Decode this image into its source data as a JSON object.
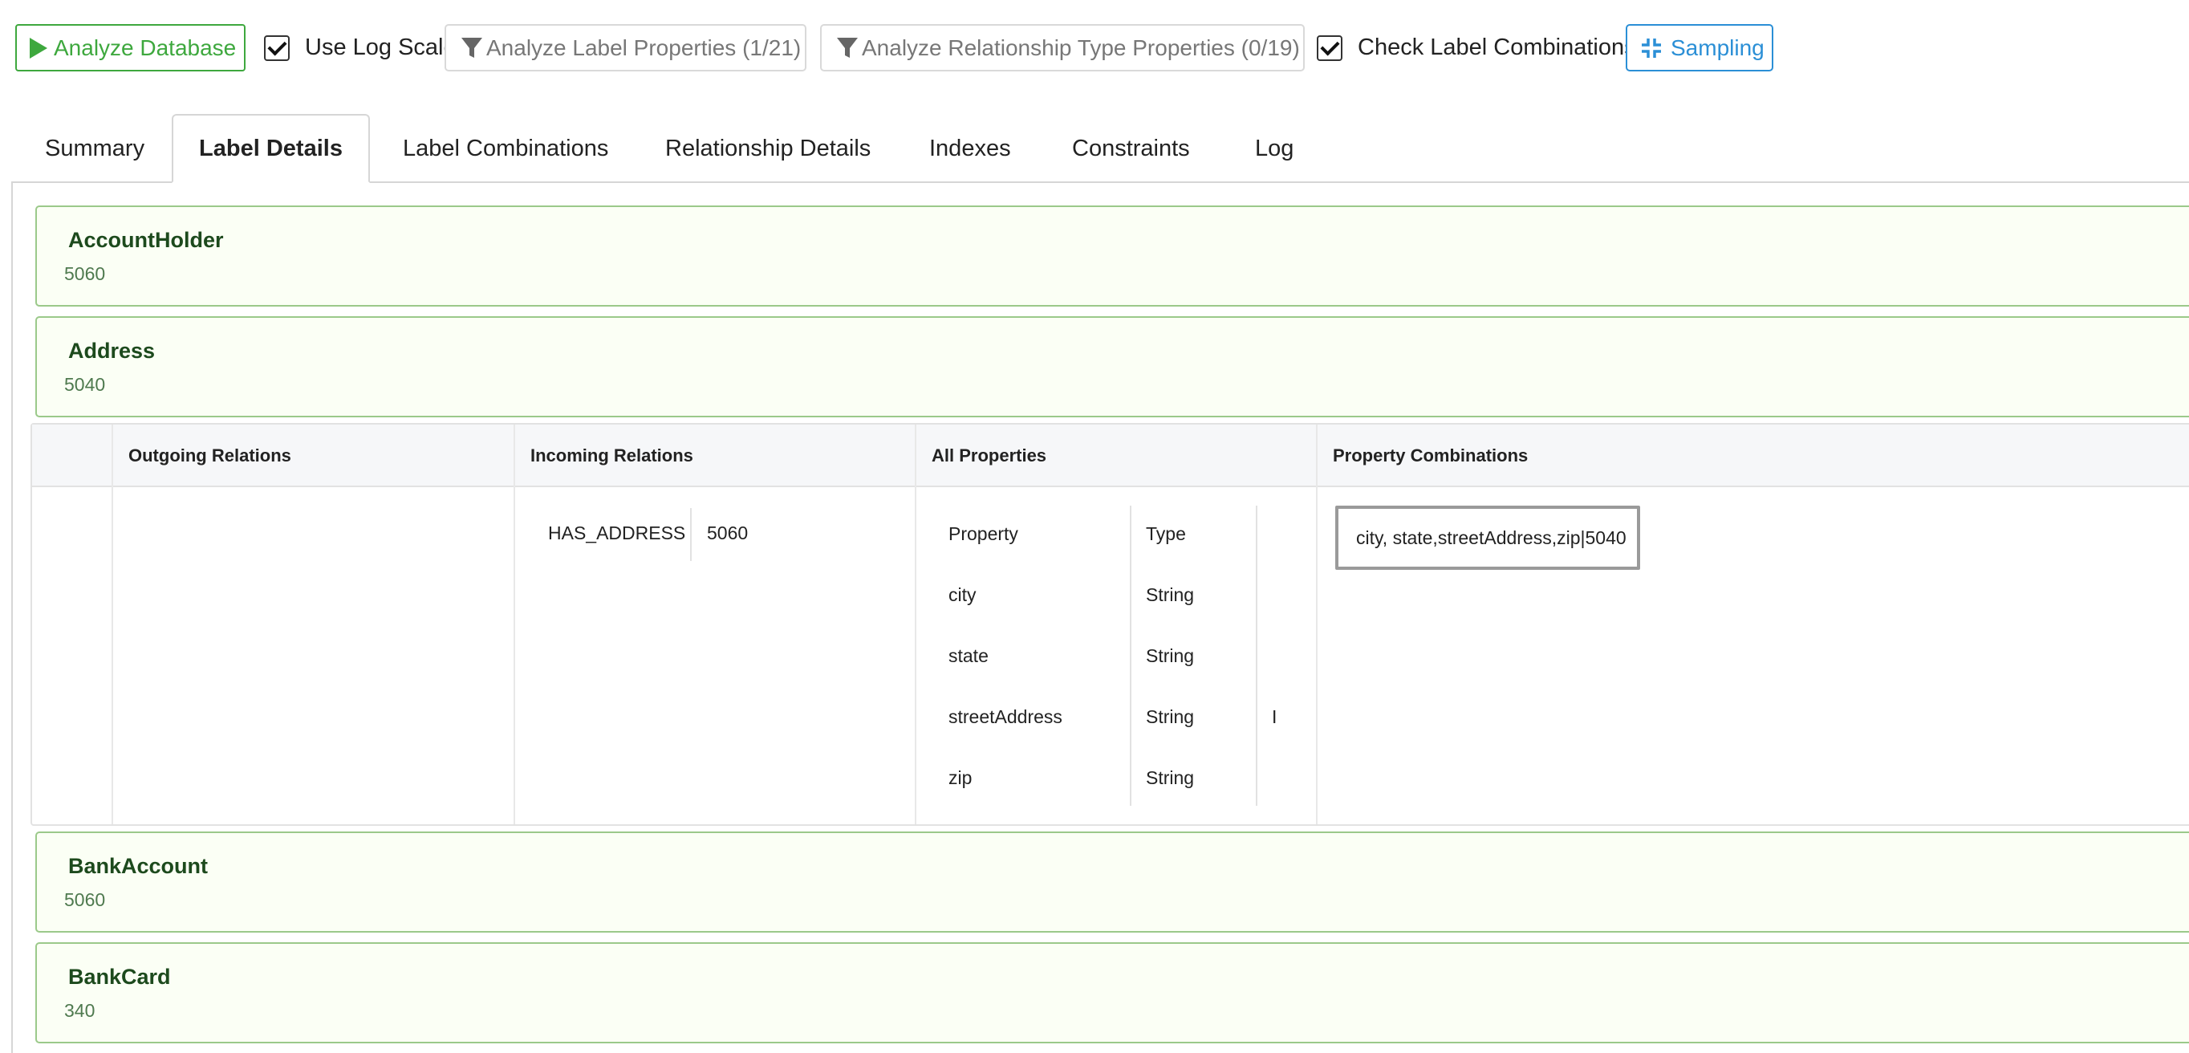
{
  "toolbar": {
    "analyze_label": "Analyze Database",
    "log_scale_label": "Use Log Scale",
    "log_scale_checked": true,
    "label_props_label": "Analyze Label Properties (1/21)",
    "rel_props_label": "Analyze Relationship Type Properties (0/19)",
    "check_combos_label": "Check Label Combinations",
    "check_combos_checked": true,
    "sampling_label": "Sampling"
  },
  "tabs": [
    {
      "label": "Summary"
    },
    {
      "label": "Label Details"
    },
    {
      "label": "Label Combinations"
    },
    {
      "label": "Relationship Details"
    },
    {
      "label": "Indexes"
    },
    {
      "label": "Constraints"
    },
    {
      "label": "Log"
    }
  ],
  "active_tab": "Label Details",
  "labels": [
    {
      "name": "AccountHolder",
      "count": "5060"
    },
    {
      "name": "Address",
      "count": "5040"
    },
    {
      "name": "BankAccount",
      "count": "5060"
    },
    {
      "name": "BankCard",
      "count": "340"
    }
  ],
  "detail": {
    "headers": {
      "outgoing": "Outgoing Relations",
      "incoming": "Incoming Relations",
      "all_properties": "All Properties",
      "combinations": "Property Combinations"
    },
    "incoming": [
      {
        "type": "HAS_ADDRESS",
        "count": "5060"
      }
    ],
    "properties_header": {
      "property": "Property",
      "type": "Type"
    },
    "properties": [
      {
        "property": "city",
        "type": "String",
        "flag": ""
      },
      {
        "property": "state",
        "type": "String",
        "flag": ""
      },
      {
        "property": "streetAddress",
        "type": "String",
        "flag": "I"
      },
      {
        "property": "zip",
        "type": "String",
        "flag": ""
      }
    ],
    "combination": "city, state,streetAddress,zip|5040"
  },
  "colors": {
    "analyze_green": "#3ea83e",
    "sampling_blue": "#2b8fd6",
    "panel_bg": "#fbfff5",
    "panel_border": "#9bc98a"
  }
}
